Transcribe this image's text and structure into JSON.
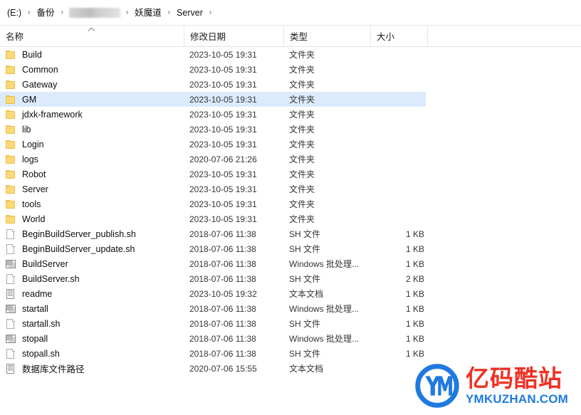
{
  "window": {
    "title": "Server"
  },
  "address_bar": {
    "crumbs": [
      {
        "label": "(E:)",
        "redacted": false
      },
      {
        "label": "备份",
        "redacted": false
      },
      {
        "label": "",
        "redacted": true
      },
      {
        "label": "妖魔道",
        "redacted": false
      },
      {
        "label": "Server",
        "redacted": false
      }
    ],
    "separator": "›"
  },
  "columns": {
    "name": "名称",
    "date_modified": "修改日期",
    "type": "类型",
    "size": "大小",
    "sort_indicator": "︿",
    "sort_direction": "ascending",
    "sorted_by": "名称"
  },
  "files": [
    {
      "name": "Build",
      "date": "2023-10-05 19:31",
      "type": "文件夹",
      "size": "",
      "icon": "folder-icon",
      "selected": false
    },
    {
      "name": "Common",
      "date": "2023-10-05 19:31",
      "type": "文件夹",
      "size": "",
      "icon": "folder-icon",
      "selected": false
    },
    {
      "name": "Gateway",
      "date": "2023-10-05 19:31",
      "type": "文件夹",
      "size": "",
      "icon": "folder-icon",
      "selected": false
    },
    {
      "name": "GM",
      "date": "2023-10-05 19:31",
      "type": "文件夹",
      "size": "",
      "icon": "folder-icon",
      "selected": true
    },
    {
      "name": "jdxk-framework",
      "date": "2023-10-05 19:31",
      "type": "文件夹",
      "size": "",
      "icon": "folder-icon",
      "selected": false
    },
    {
      "name": "lib",
      "date": "2023-10-05 19:31",
      "type": "文件夹",
      "size": "",
      "icon": "folder-icon",
      "selected": false
    },
    {
      "name": "Login",
      "date": "2023-10-05 19:31",
      "type": "文件夹",
      "size": "",
      "icon": "folder-icon",
      "selected": false
    },
    {
      "name": "logs",
      "date": "2020-07-06 21:26",
      "type": "文件夹",
      "size": "",
      "icon": "folder-icon",
      "selected": false
    },
    {
      "name": "Robot",
      "date": "2023-10-05 19:31",
      "type": "文件夹",
      "size": "",
      "icon": "folder-icon",
      "selected": false
    },
    {
      "name": "Server",
      "date": "2023-10-05 19:31",
      "type": "文件夹",
      "size": "",
      "icon": "folder-icon",
      "selected": false
    },
    {
      "name": "tools",
      "date": "2023-10-05 19:31",
      "type": "文件夹",
      "size": "",
      "icon": "folder-icon",
      "selected": false
    },
    {
      "name": "World",
      "date": "2023-10-05 19:31",
      "type": "文件夹",
      "size": "",
      "icon": "folder-icon",
      "selected": false
    },
    {
      "name": "BeginBuildServer_publish.sh",
      "date": "2018-07-06 11:38",
      "type": "SH 文件",
      "size": "1 KB",
      "icon": "file-icon",
      "selected": false
    },
    {
      "name": "BeginBuildServer_update.sh",
      "date": "2018-07-06 11:38",
      "type": "SH 文件",
      "size": "1 KB",
      "icon": "file-icon",
      "selected": false
    },
    {
      "name": "BuildServer",
      "date": "2018-07-06 11:38",
      "type": "Windows 批处理...",
      "size": "1 KB",
      "icon": "batch-file-icon",
      "selected": false
    },
    {
      "name": "BuildServer.sh",
      "date": "2018-07-06 11:38",
      "type": "SH 文件",
      "size": "2 KB",
      "icon": "file-icon",
      "selected": false
    },
    {
      "name": "readme",
      "date": "2023-10-05 19:32",
      "type": "文本文档",
      "size": "1 KB",
      "icon": "text-document-icon",
      "selected": false
    },
    {
      "name": "startall",
      "date": "2018-07-06 11:38",
      "type": "Windows 批处理...",
      "size": "1 KB",
      "icon": "batch-file-icon",
      "selected": false
    },
    {
      "name": "startall.sh",
      "date": "2018-07-06 11:38",
      "type": "SH 文件",
      "size": "1 KB",
      "icon": "file-icon",
      "selected": false
    },
    {
      "name": "stopall",
      "date": "2018-07-06 11:38",
      "type": "Windows 批处理...",
      "size": "1 KB",
      "icon": "batch-file-icon",
      "selected": false
    },
    {
      "name": "stopall.sh",
      "date": "2018-07-06 11:38",
      "type": "SH 文件",
      "size": "1 KB",
      "icon": "file-icon",
      "selected": false
    },
    {
      "name": "数据库文件路径",
      "date": "2020-07-06 15:55",
      "type": "文本文档",
      "size": "",
      "icon": "text-document-icon",
      "selected": false
    }
  ],
  "watermark": {
    "monogram": "YM",
    "cn_text": "亿码酷站",
    "en_text": "YMKUZHAN.COM",
    "logo_color": "#1f7ae0",
    "cn_color": "#ee3124",
    "en_color": "#1f7ae0"
  },
  "colors": {
    "selection": "#dbeafc",
    "folder": "#fbd978",
    "text": "#0d0d0d",
    "secondary_text": "#353535",
    "divider": "#e6e6e6"
  }
}
